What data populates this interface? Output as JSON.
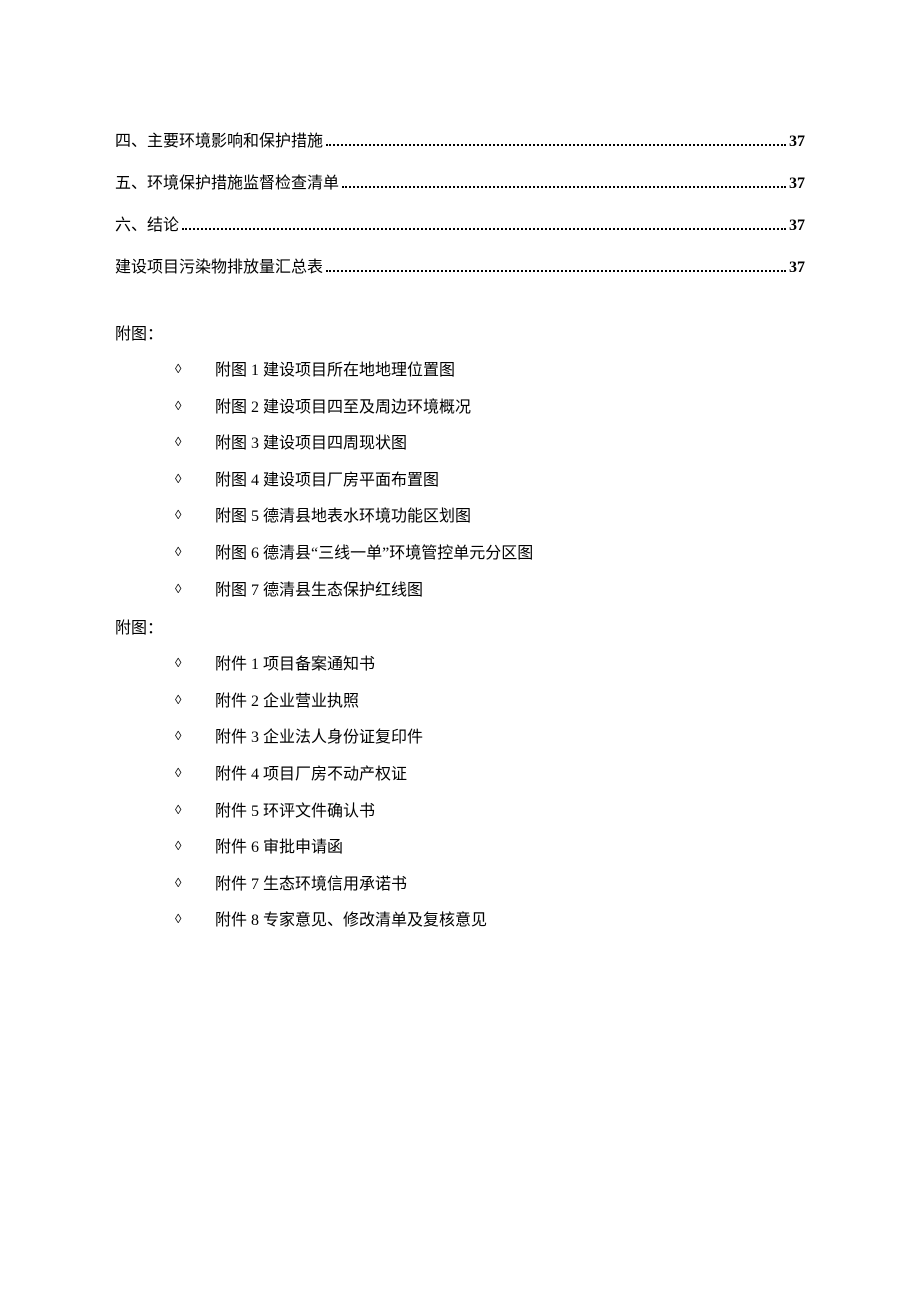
{
  "toc": [
    {
      "title": "四、主要环境影响和保护措施",
      "page": "37"
    },
    {
      "title": "五、环境保护措施监督检查清单",
      "page": "37"
    },
    {
      "title": "六、结论",
      "page": "37"
    },
    {
      "title": "建设项目污染物排放量汇总表",
      "page": "37"
    }
  ],
  "appendix_a": {
    "label": "附图：",
    "items": [
      "附图 1 建设项目所在地地理位置图",
      "附图 2 建设项目四至及周边环境概况",
      "附图 3 建设项目四周现状图",
      "附图 4 建设项目厂房平面布置图",
      "附图 5 德清县地表水环境功能区划图",
      "附图 6 德清县“三线一单”环境管控单元分区图",
      "附图 7 德清县生态保护红线图"
    ]
  },
  "appendix_b": {
    "label": "附图：",
    "items": [
      "附件 1 项目备案通知书",
      "附件 2 企业营业执照",
      "附件 3 企业法人身份证复印件",
      "附件 4 项目厂房不动产权证",
      "附件 5 环评文件确认书",
      "附件 6 审批申请函",
      "附件 7 生态环境信用承诺书",
      "附件 8 专家意见、修改清单及复核意见"
    ]
  },
  "bullet": "◊"
}
